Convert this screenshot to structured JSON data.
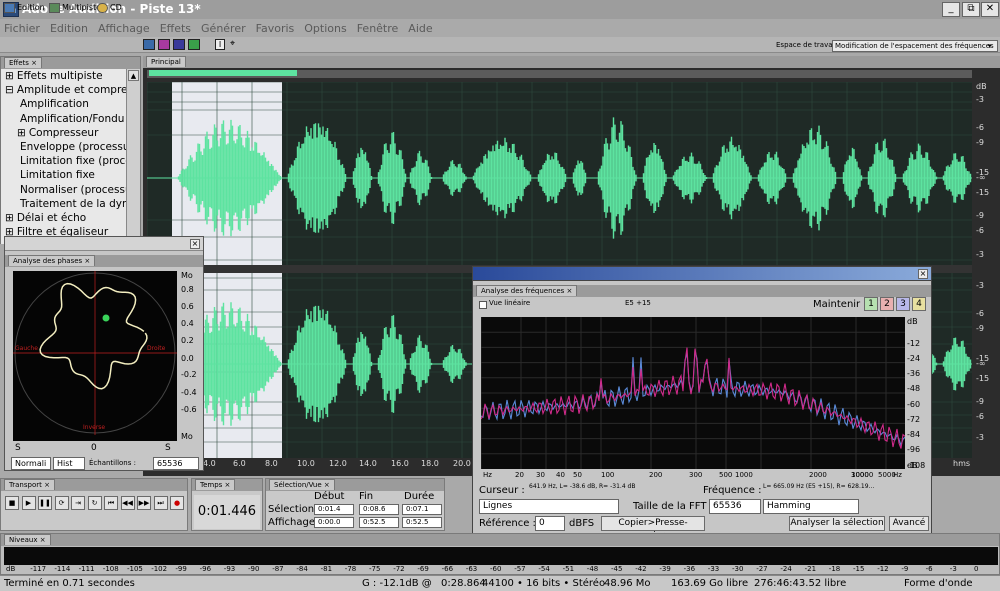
{
  "app": {
    "title": "Adobe Audition - Piste 13*",
    "icon_text": "Au",
    "minimize": "_",
    "restore": "⧉",
    "close": "✕"
  },
  "menu": [
    "Fichier",
    "Edition",
    "Affichage",
    "Effets",
    "Générer",
    "Favoris",
    "Options",
    "Fenêtre",
    "Aide"
  ],
  "toolbar": {
    "edition": "Edition",
    "multipiste": "Multipiste",
    "cd": "CD",
    "workspace_label": "Espace de travail :",
    "workspace_value": "Modification de l'espacement des fréquences"
  },
  "effects": {
    "tab": "Effets",
    "items": [
      {
        "label": "Effets multipiste",
        "level": 0,
        "prefix": "⊞"
      },
      {
        "label": "Amplitude et compressio",
        "level": 0,
        "prefix": "⊟"
      },
      {
        "label": "Amplification",
        "level": 1,
        "prefix": ""
      },
      {
        "label": "Amplification/Fondu (",
        "level": 1,
        "prefix": ""
      },
      {
        "label": "Compresseur",
        "level": 1,
        "prefix": "⊞"
      },
      {
        "label": "Enveloppe (processus",
        "level": 1,
        "prefix": ""
      },
      {
        "label": "Limitation fixe (proces",
        "level": 1,
        "prefix": ""
      },
      {
        "label": "Limitation fixe",
        "level": 1,
        "prefix": ""
      },
      {
        "label": "Normaliser (processus",
        "level": 1,
        "prefix": ""
      },
      {
        "label": "Traitement de la dyna",
        "level": 1,
        "prefix": ""
      },
      {
        "label": "Délai et écho",
        "level": 0,
        "prefix": "⊞"
      },
      {
        "label": "Filtre et égaliseur",
        "level": 0,
        "prefix": "⊞"
      }
    ]
  },
  "main": {
    "tab": "Principal",
    "db_unit": "dB",
    "db_labels_top": [
      "-3",
      "-6",
      "-9",
      "-15",
      "-∞",
      "-15",
      "-9",
      "-6",
      "-3"
    ],
    "db_labels_bottom": [
      "-3",
      "-6",
      "-9",
      "-15",
      "-∞",
      "-15",
      "-9",
      "-6",
      "-3"
    ],
    "time_labels": [
      "4.0",
      "6.0",
      "8.0",
      "10.0",
      "12.0",
      "14.0",
      "16.0",
      "18.0",
      "20.0"
    ],
    "time_unit": "hms"
  },
  "phase": {
    "tab": "Analyse des phases",
    "scale": [
      "Mo",
      "0.8",
      "0.6",
      "0.4",
      "0.2",
      "0.0",
      "-0.2",
      "-0.4",
      "-0.6",
      "Mo"
    ],
    "bottom_scale": [
      "S",
      "0",
      "S"
    ],
    "label_left": "Gauche",
    "label_right": "Droite",
    "label_bottom": "Inverse",
    "mode_select": "Normali",
    "hist_select": "Hist",
    "samples_label": "Échantillons :",
    "samples_value": "65536"
  },
  "freq": {
    "tab": "Analyse des fréquences",
    "linear_view": "Vue linéaire",
    "cursor_note": "E5 +15",
    "hold_label": "Maintenir :",
    "hold_buttons": [
      "1",
      "2",
      "3",
      "4"
    ],
    "db_scale": [
      "dB",
      "-12",
      "-24",
      "-36",
      "-48",
      "-60",
      "-72",
      "-84",
      "-96",
      "-108",
      "dB"
    ],
    "x_labels": [
      "Hz",
      "20",
      "30",
      "40",
      "50",
      "100",
      "200",
      "300",
      "500",
      "1000",
      "2000",
      "3000",
      "5000",
      "10000",
      "Hz"
    ],
    "cursor_label": "Curseur :",
    "cursor_value": "641.9 Hz, L= -38.6 dB, R= -31.4 dB",
    "frequency_label": "Fréquence :",
    "frequency_value": "L= 665.09 Hz (E5 +15), R= 628.19...",
    "plot_select": "Lignes",
    "fft_label": "Taille de la FFT :",
    "fft_value": "65536",
    "window_value": "Hamming",
    "reference_label": "Référence :",
    "reference_value": "0",
    "reference_unit": "dBFS",
    "copy_button": "Copier>Presse-papiers",
    "analyze_button": "Analyser la sélection",
    "advanced_button": "Avancé"
  },
  "transport": {
    "tab": "Transport"
  },
  "temps": {
    "tab": "Temps",
    "value": "0:01.446"
  },
  "selection": {
    "tab": "Sélection/Vue",
    "col_start": "Début",
    "col_end": "Fin",
    "col_dur": "Durée",
    "row_sel": "Sélection",
    "row_view": "Affichage",
    "sel_start": "0:01.4",
    "sel_end": "0:08.6",
    "sel_dur": "0:07.1",
    "view_start": "0:00.0",
    "view_end": "0:52.5",
    "view_dur": "0:52.5"
  },
  "levels": {
    "tab": "Niveaux",
    "scale": [
      "dB",
      "-117",
      "-114",
      "-111",
      "-108",
      "-105",
      "-102",
      "-99",
      "-96",
      "-93",
      "-90",
      "-87",
      "-84",
      "-81",
      "-78",
      "-75",
      "-72",
      "-69",
      "-66",
      "-63",
      "-60",
      "-57",
      "-54",
      "-51",
      "-48",
      "-45",
      "-42",
      "-39",
      "-36",
      "-33",
      "-30",
      "-27",
      "-24",
      "-21",
      "-18",
      "-15",
      "-12",
      "-9",
      "-6",
      "-3",
      "0"
    ]
  },
  "status": {
    "left": "Terminé en 0.71 secondes",
    "gain": "G : -12.1dB @",
    "time": "0:28.864",
    "format": "44100 • 16 bits • Stéréo",
    "size": "48.96 Mo",
    "free": "163.69 Go libre",
    "free_time": "276:46:43.52 libre",
    "mode": "Forme d'onde"
  },
  "colors": {
    "wave": "#5de3a0",
    "wave_dark": "#2f6a4e",
    "accent": "#2a5aa8"
  }
}
